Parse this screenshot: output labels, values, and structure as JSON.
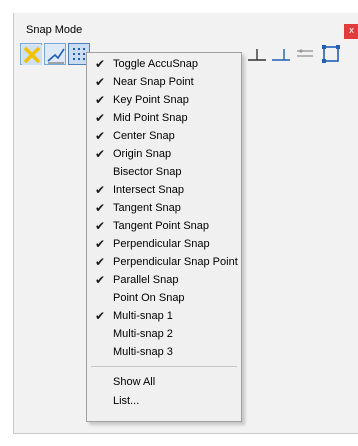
{
  "window": {
    "title": "Snap Mode",
    "close_glyph": "x"
  },
  "toolbar": {
    "buttons": [
      {
        "name": "keypoint-x-icon",
        "selected": true
      },
      {
        "name": "nearest-line-icon",
        "selected": true
      },
      {
        "name": "grid-dots-icon",
        "selected": true
      },
      {
        "name": "perpendicular-icon",
        "selected": false
      },
      {
        "name": "perpendicular-point-icon",
        "selected": false
      },
      {
        "name": "parallel-icon",
        "selected": false
      },
      {
        "name": "multi-snap-icon",
        "selected": false
      }
    ]
  },
  "menu": {
    "items": [
      {
        "label": "Toggle AccuSnap",
        "checked": true
      },
      {
        "label": "Near Snap Point",
        "checked": true
      },
      {
        "label": "Key Point Snap",
        "checked": true
      },
      {
        "label": "Mid Point Snap",
        "checked": true
      },
      {
        "label": "Center Snap",
        "checked": true
      },
      {
        "label": "Origin Snap",
        "checked": true
      },
      {
        "label": "Bisector Snap",
        "checked": false
      },
      {
        "label": "Intersect Snap",
        "checked": true
      },
      {
        "label": "Tangent Snap",
        "checked": true
      },
      {
        "label": "Tangent Point Snap",
        "checked": true
      },
      {
        "label": "Perpendicular Snap",
        "checked": true
      },
      {
        "label": "Perpendicular Snap Point",
        "checked": true
      },
      {
        "label": "Parallel Snap",
        "checked": true
      },
      {
        "label": "Point On Snap",
        "checked": false
      },
      {
        "label": "Multi-snap 1",
        "checked": true
      },
      {
        "label": "Multi-snap 2",
        "checked": false
      },
      {
        "label": "Multi-snap 3",
        "checked": false
      }
    ],
    "footer_items": [
      {
        "label": "Show All"
      },
      {
        "label": "List..."
      }
    ],
    "check_glyph": "✔"
  },
  "colors": {
    "close_button": "#e23b3b",
    "selection_border": "#4b7fbf",
    "keypoint_icon": "#f2c200",
    "snap_icon_blue": "#1f5fb8"
  }
}
